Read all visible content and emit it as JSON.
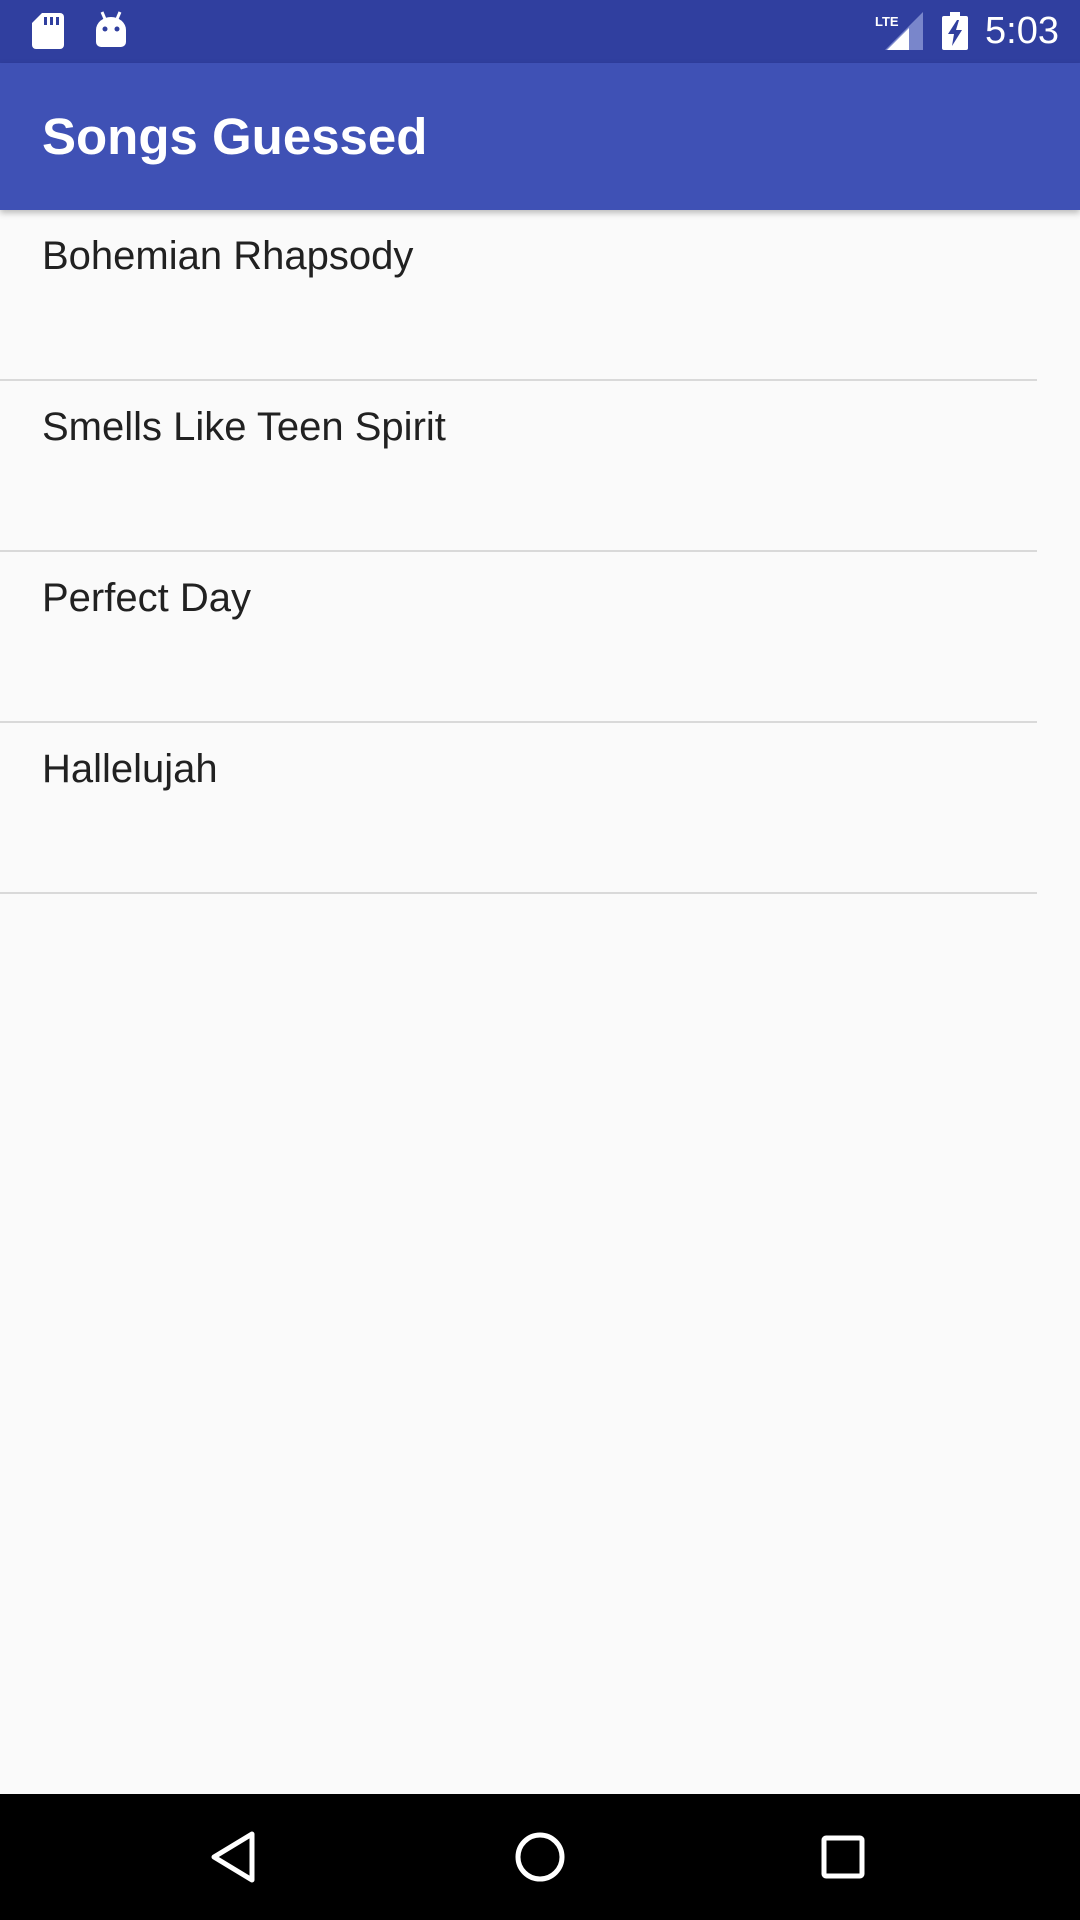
{
  "status_bar": {
    "time": "5:03",
    "network": "LTE",
    "icons": [
      "sd-card-icon",
      "android-debug-icon",
      "lte-signal-icon",
      "battery-charging-icon"
    ]
  },
  "app_bar": {
    "title": "Songs Guessed",
    "color": "#3f51b5"
  },
  "songs": [
    {
      "title": "Bohemian Rhapsody"
    },
    {
      "title": "Smells Like Teen Spirit"
    },
    {
      "title": "Perfect Day"
    },
    {
      "title": "Hallelujah"
    }
  ],
  "nav_bar": {
    "buttons": [
      "back-icon",
      "home-icon",
      "recents-icon"
    ]
  },
  "colors": {
    "status_bar": "#303f9f",
    "app_bar": "#3f51b5",
    "background": "#fafafa",
    "divider": "#d9d9d9",
    "text": "#212121"
  }
}
